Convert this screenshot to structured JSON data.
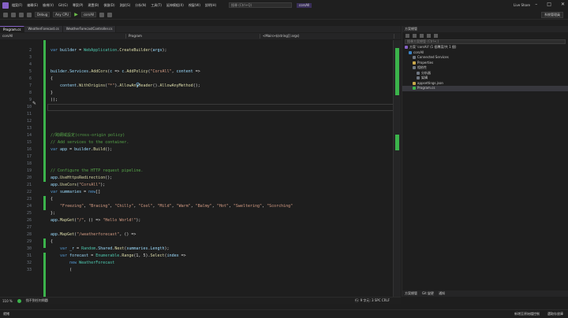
{
  "menubar": {
    "items": [
      "檔案(F)",
      "編輯(E)",
      "檢視(V)",
      "Git(G)",
      "專案(P)",
      "建置(B)",
      "偵錯(D)",
      "測試(S)",
      "分析(N)",
      "工具(T)",
      "延伸模組(X)",
      "視窗(W)",
      "說明(H)"
    ],
    "search": "搜尋 (Ctrl+Q)",
    "project": "corsAll",
    "liveshare": "Live Share"
  },
  "toolbar": {
    "config": "Debug",
    "platform": "Any CPU",
    "run_target": "corsAll",
    "copilot": "系統管理員"
  },
  "tabs": [
    {
      "label": "Program.cs",
      "active": true
    },
    {
      "label": "WeatherForecast.cs",
      "active": false
    },
    {
      "label": "WeatherForecastController.cs",
      "active": false
    }
  ],
  "navbar": [
    "corsAll",
    "Program",
    "<Main>$(string[] args)"
  ],
  "editor": {
    "lines": [
      {
        "n": 2,
        "html": "<span class=\"kw\">var</span> <span class=\"vr\">builder</span> = <span class=\"ty\">WebApplication</span>.<span class=\"mt\">CreateBuilder</span>(<span class=\"vr\">args</span>);"
      },
      {
        "n": 3,
        "html": ""
      },
      {
        "n": 4,
        "html": ""
      },
      {
        "n": 5,
        "html": "<span class=\"vr\">builder</span>.<span class=\"vr\">Services</span>.<span class=\"mt\">AddCors</span>(<span class=\"vr\">c</span> => <span class=\"vr\">c</span>.<span class=\"mt\">AddPolicy</span>(<span class=\"st\">\"CorsAll\"</span>, <span class=\"vr\">content</span> =>"
      },
      {
        "n": 6,
        "html": "{"
      },
      {
        "n": 7,
        "html": "    <span class=\"vr\">content</span>.<span class=\"mt\">WithOrigins</span>(<span class=\"st\">\"*\"</span>).<span class=\"mt\">AllowAnyHeader</span>().<span class=\"mt\">AllowAnyMethod</span>();"
      },
      {
        "n": 8,
        "html": "}"
      },
      {
        "n": 9,
        "html": "));"
      },
      {
        "n": 10,
        "html": ""
      },
      {
        "n": 11,
        "html": ""
      },
      {
        "n": 12,
        "html": ""
      },
      {
        "n": 13,
        "html": ""
      },
      {
        "n": 14,
        "html": "<span class=\"cm\">//跨網域設定(cross-origin policy)</span>"
      },
      {
        "n": 15,
        "html": "<span class=\"cm\">// Add services to the container.</span>"
      },
      {
        "n": 16,
        "html": "<span class=\"kw\">var</span> <span class=\"vr\">app</span> = <span class=\"vr\">builder</span>.<span class=\"mt\">Build</span>();"
      },
      {
        "n": 17,
        "html": ""
      },
      {
        "n": 18,
        "html": ""
      },
      {
        "n": 19,
        "html": "<span class=\"cm\">// Configure the HTTP request pipeline.</span>"
      },
      {
        "n": 20,
        "html": "<span class=\"vr\">app</span>.<span class=\"mt\">UseHttpsRedirection</span>();"
      },
      {
        "n": 21,
        "html": "<span class=\"vr\">app</span>.<span class=\"mt\">UseCors</span>(<span class=\"st\">\"CorsAll\"</span>);"
      },
      {
        "n": 22,
        "html": "<span class=\"kw\">var</span> <span class=\"vr\">summaries</span> = <span class=\"kw\">new</span>[]"
      },
      {
        "n": 23,
        "html": "{"
      },
      {
        "n": 24,
        "html": "    <span class=\"st\">\"Freezing\"</span>, <span class=\"st\">\"Bracing\"</span>, <span class=\"st\">\"Chilly\"</span>, <span class=\"st\">\"Cool\"</span>, <span class=\"st\">\"Mild\"</span>, <span class=\"st\">\"Warm\"</span>, <span class=\"st\">\"Balmy\"</span>, <span class=\"st\">\"Hot\"</span>, <span class=\"st\">\"Sweltering\"</span>, <span class=\"st\">\"Scorching\"</span>"
      },
      {
        "n": 25,
        "html": "};"
      },
      {
        "n": 26,
        "html": "<span class=\"vr\">app</span>.<span class=\"mt\">MapGet</span>(<span class=\"st\">\"/\"</span>, () => <span class=\"st\">\"Hello World!\"</span>);"
      },
      {
        "n": 27,
        "html": ""
      },
      {
        "n": 28,
        "html": "<span class=\"vr\">app</span>.<span class=\"mt\">MapGet</span>(<span class=\"st\">\"/weatherforecast\"</span>, () =>"
      },
      {
        "n": 29,
        "html": "{"
      },
      {
        "n": 30,
        "html": "    <span class=\"kw\">var</span> <span class=\"vr\">_r</span> = <span class=\"ty\">Random</span>.<span class=\"vr\">Shared</span>.<span class=\"mt\">Next</span>(<span class=\"vr\">summaries</span>.<span class=\"vr\">Length</span>);"
      },
      {
        "n": 31,
        "html": "    <span class=\"kw\">var</span> <span class=\"vr\">forecast</span> = <span class=\"ty\">Enumerable</span>.<span class=\"mt\">Range</span>(1, 5).<span class=\"mt\">Select</span>(<span class=\"vr\">index</span> =>"
      },
      {
        "n": 32,
        "html": "        <span class=\"kw\">new</span> <span class=\"ty\">WeatherForecast</span>"
      },
      {
        "n": 33,
        "html": "        ("
      }
    ]
  },
  "solution_explorer": {
    "title": "方案總管",
    "search": "搜尋方案總管 (Ctrl+;)",
    "items": [
      {
        "label": "方案 'corsAll' (1 個專案/共 1 個)",
        "indent": 0,
        "color": "#8661c5",
        "selected": false
      },
      {
        "label": "corsAll",
        "indent": 1,
        "color": "#3b82c4",
        "selected": false
      },
      {
        "label": "Connected Services",
        "indent": 2,
        "color": "#6e7681",
        "selected": false
      },
      {
        "label": "Properties",
        "indent": 2,
        "color": "#c8a84b",
        "selected": false
      },
      {
        "label": "相依性",
        "indent": 2,
        "color": "#6e7681",
        "selected": false
      },
      {
        "label": "分析器",
        "indent": 3,
        "color": "#6e7681",
        "selected": false
      },
      {
        "label": "架構",
        "indent": 3,
        "color": "#6e7681",
        "selected": false
      },
      {
        "label": "appsettings.json",
        "indent": 2,
        "color": "#c8a84b",
        "selected": false
      },
      {
        "label": "Program.cs",
        "indent": 2,
        "color": "#3bb34b",
        "selected": true
      }
    ],
    "bottom_tabs": [
      "方案總管",
      "Git 變更",
      "通知"
    ]
  },
  "bottom_info": {
    "zoom": "110 %",
    "issues": "找不到任何問題",
    "position": "行: 9  字元: 3  SPC  CRLF"
  },
  "statusbar": {
    "left": "就緒",
    "right1": "新增至原始檔控制",
    "right2": "選取存放庫"
  }
}
